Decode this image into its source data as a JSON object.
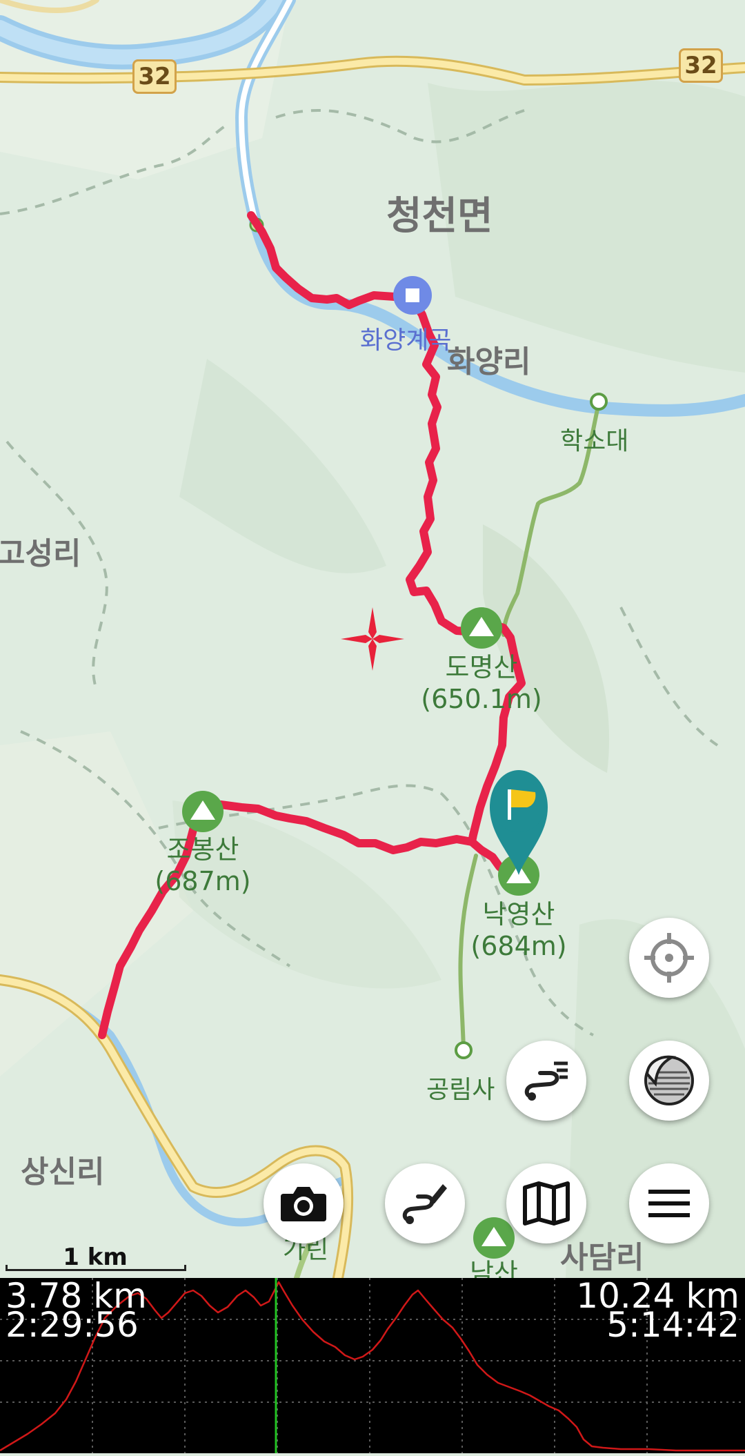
{
  "map": {
    "places": [
      {
        "name": "청천면"
      },
      {
        "name": "화양리"
      },
      {
        "name": "고성리"
      },
      {
        "name": "상신리"
      },
      {
        "name": "사담리"
      }
    ],
    "pois": [
      {
        "name": "화양계곡"
      },
      {
        "name": "학소대"
      },
      {
        "name": "공림사"
      }
    ],
    "peaks": [
      {
        "name": "도명산",
        "elevation": "(650.1m)"
      },
      {
        "name": "조봉산",
        "elevation": "(687m)"
      },
      {
        "name": "낙영산",
        "elevation": "(684m)"
      },
      {
        "name": "남산",
        "elevation": ""
      }
    ],
    "road_shields": [
      "32",
      "32"
    ],
    "partial_label": "가린",
    "scale_label": "1 km",
    "accent_route_color": "#e8224a",
    "marker_color": "#1f8e94",
    "flag_color": "#f5c518"
  },
  "buttons": {
    "locate": {
      "icon": "crosshair-target-icon"
    },
    "route_list": {
      "icon": "route-list-icon"
    },
    "layers": {
      "icon": "map-layer-peel-icon"
    },
    "camera": {
      "icon": "camera-icon"
    },
    "draw_route": {
      "icon": "route-edit-pencil-icon"
    },
    "map": {
      "icon": "folded-map-icon"
    },
    "menu": {
      "icon": "hamburger-menu-icon"
    }
  },
  "elevation_panel": {
    "cursor_distance": "3.78 km",
    "cursor_time": "2:29:56",
    "total_distance": "10.24 km",
    "total_time": "5:14:42",
    "cursor_position_fraction": 0.37,
    "profile_color": "#d01818",
    "cursor_color": "#22c222"
  }
}
